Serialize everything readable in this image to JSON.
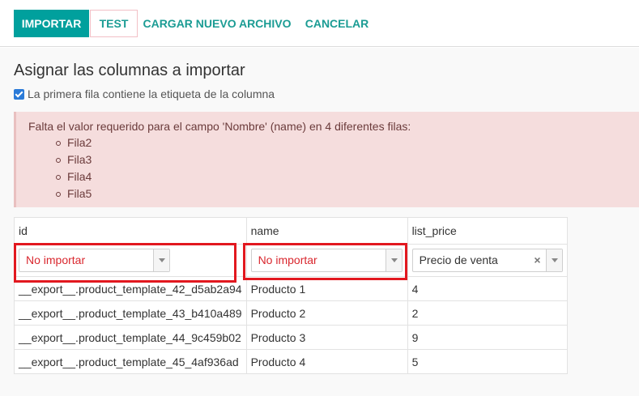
{
  "toolbar": {
    "import_label": "IMPORTAR",
    "test_label": "TEST",
    "upload_label": "CARGAR NUEVO ARCHIVO",
    "cancel_label": "CANCELAR"
  },
  "page": {
    "title": "Asignar las columnas a importar",
    "header_checkbox_label": "La primera fila contiene la etiqueta de la columna",
    "header_checkbox_checked": true
  },
  "alert": {
    "message": "Falta el valor requerido para el campo 'Nombre' (name) en 4 diferentes filas:",
    "rows": [
      "Fila2",
      "Fila3",
      "Fila4",
      "Fila5"
    ]
  },
  "table": {
    "columns": [
      "id",
      "name",
      "list_price"
    ],
    "mappings": [
      "No importar",
      "No importar",
      "Precio de venta"
    ],
    "clear_glyph": "×",
    "rows": [
      [
        "__export__.product_template_42_d5ab2a94",
        "Producto 1",
        "4"
      ],
      [
        "__export__.product_template_43_b410a489",
        "Producto 2",
        "2"
      ],
      [
        "__export__.product_template_44_9c459b02",
        "Producto 3",
        "9"
      ],
      [
        "__export__.product_template_45_4af936ad",
        "Producto 4",
        "5"
      ]
    ]
  },
  "colors": {
    "primary": "#00a09d",
    "link": "#1b9c94",
    "error_text": "#d9272e",
    "highlight": "#e2181f",
    "alert_bg": "#f5dddd"
  }
}
